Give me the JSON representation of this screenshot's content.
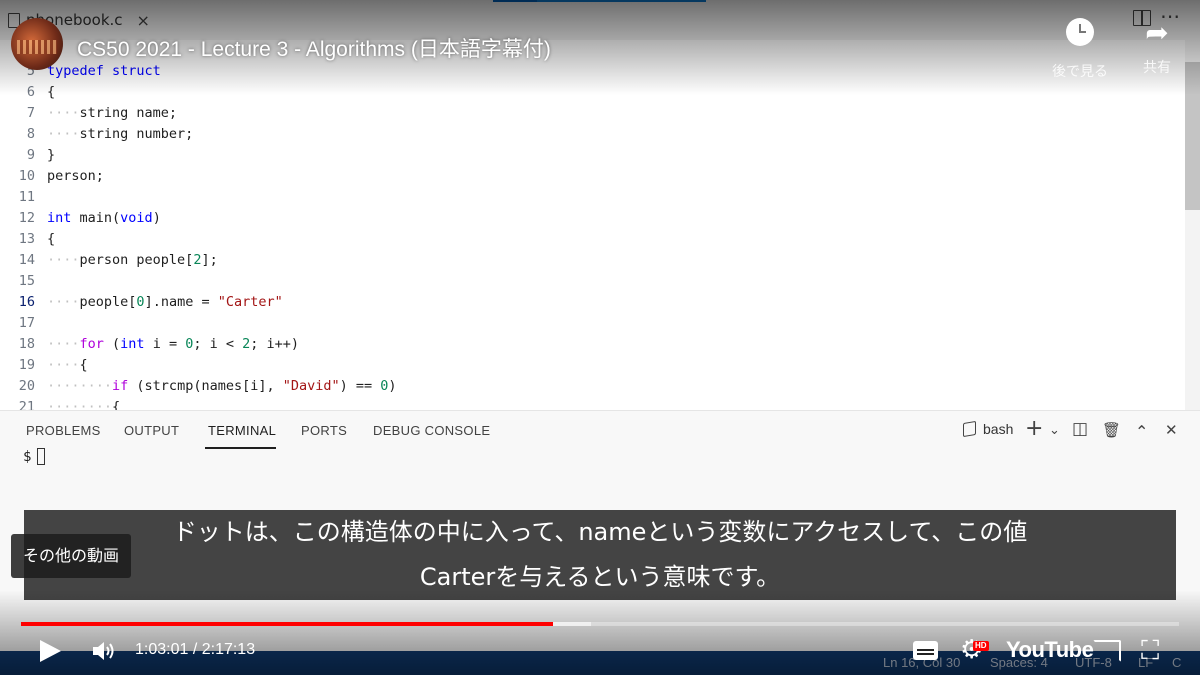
{
  "editor": {
    "tab_label": "phonebook.c",
    "tab_close": "×",
    "more_glyph": "⋯",
    "lines": [
      {
        "n": "5",
        "parts": [
          [
            "kw",
            "typedef"
          ],
          [
            "",
            " "
          ],
          [
            "kw",
            "struct"
          ]
        ]
      },
      {
        "n": "6",
        "parts": [
          [
            "",
            "{"
          ]
        ]
      },
      {
        "n": "7",
        "parts": [
          [
            "ws",
            "····"
          ],
          [
            "",
            "string name;"
          ]
        ]
      },
      {
        "n": "8",
        "parts": [
          [
            "ws",
            "····"
          ],
          [
            "",
            "string number;"
          ]
        ]
      },
      {
        "n": "9",
        "parts": [
          [
            "",
            "}"
          ]
        ]
      },
      {
        "n": "10",
        "parts": [
          [
            "",
            "person;"
          ]
        ]
      },
      {
        "n": "11",
        "parts": []
      },
      {
        "n": "12",
        "parts": [
          [
            "kw",
            "int"
          ],
          [
            "",
            " main("
          ],
          [
            "kw",
            "void"
          ],
          [
            "",
            ")"
          ]
        ]
      },
      {
        "n": "13",
        "parts": [
          [
            "",
            "{"
          ]
        ]
      },
      {
        "n": "14",
        "parts": [
          [
            "ws",
            "····"
          ],
          [
            "",
            "person people["
          ],
          [
            "num",
            "2"
          ],
          [
            "",
            "];"
          ]
        ]
      },
      {
        "n": "15",
        "parts": []
      },
      {
        "n": "16",
        "active": true,
        "parts": [
          [
            "ws",
            "····"
          ],
          [
            "",
            "people["
          ],
          [
            "num",
            "0"
          ],
          [
            "",
            "].name = "
          ],
          [
            "str",
            "\"Carter\""
          ]
        ]
      },
      {
        "n": "17",
        "parts": []
      },
      {
        "n": "18",
        "parts": [
          [
            "ws",
            "····"
          ],
          [
            "ctl",
            "for"
          ],
          [
            "",
            " ("
          ],
          [
            "kw",
            "int"
          ],
          [
            "",
            " i = "
          ],
          [
            "num",
            "0"
          ],
          [
            "",
            "; i < "
          ],
          [
            "num",
            "2"
          ],
          [
            "",
            "; i++)"
          ]
        ]
      },
      {
        "n": "19",
        "parts": [
          [
            "ws",
            "····"
          ],
          [
            "",
            "{"
          ]
        ]
      },
      {
        "n": "20",
        "parts": [
          [
            "ws",
            "········"
          ],
          [
            "ctl",
            "if"
          ],
          [
            "",
            " (strcmp(names[i], "
          ],
          [
            "str",
            "\"David\""
          ],
          [
            "",
            ") == "
          ],
          [
            "num",
            "0"
          ],
          [
            "",
            ")"
          ]
        ]
      },
      {
        "n": "21",
        "parts": [
          [
            "ws",
            "········"
          ],
          [
            "",
            "{"
          ]
        ]
      }
    ]
  },
  "panel": {
    "tabs": [
      "PROBLEMS",
      "OUTPUT",
      "TERMINAL",
      "PORTS",
      "DEBUG CONSOLE"
    ],
    "active_tab": "TERMINAL",
    "shell": "bash",
    "icons": {
      "add": "+",
      "chevron": "⌄",
      "split": "◫",
      "trash": "🗑",
      "maximize": "⌃",
      "close": "✕"
    },
    "prompt": "$"
  },
  "statusbar": {
    "position": "Ln 16, Col 30",
    "spaces": "Spaces: 4",
    "encoding": "UTF-8",
    "eol": "LF",
    "language": "C"
  },
  "player": {
    "video_title": "CS50 2021 - Lecture 3 - Algorithms (日本語字幕付)",
    "watch_later": "後で見る",
    "share": "共有",
    "more_videos": "その他の動画",
    "caption_line1": "ドットは、この構造体の中に入って、nameという変数にアクセスして、この値",
    "caption_line2": "Carterを与えるという意味です。",
    "current_time": "1:03:01",
    "duration": "2:17:13",
    "time_text": "1:03:01 / 2:17:13",
    "played_fraction": 0.459,
    "buffered_fraction": 0.492,
    "hd_badge": "HD",
    "logo_text": "YouTube",
    "settings_glyph": "⚙",
    "fullscreen_glyph": "⛶",
    "share_glyph": "➦"
  },
  "colors": {
    "accent_red": "#ff0000",
    "statusbar": "#0f3b73",
    "keyword": "#0000ff",
    "control": "#af00db",
    "string": "#a31515",
    "number": "#098658"
  }
}
